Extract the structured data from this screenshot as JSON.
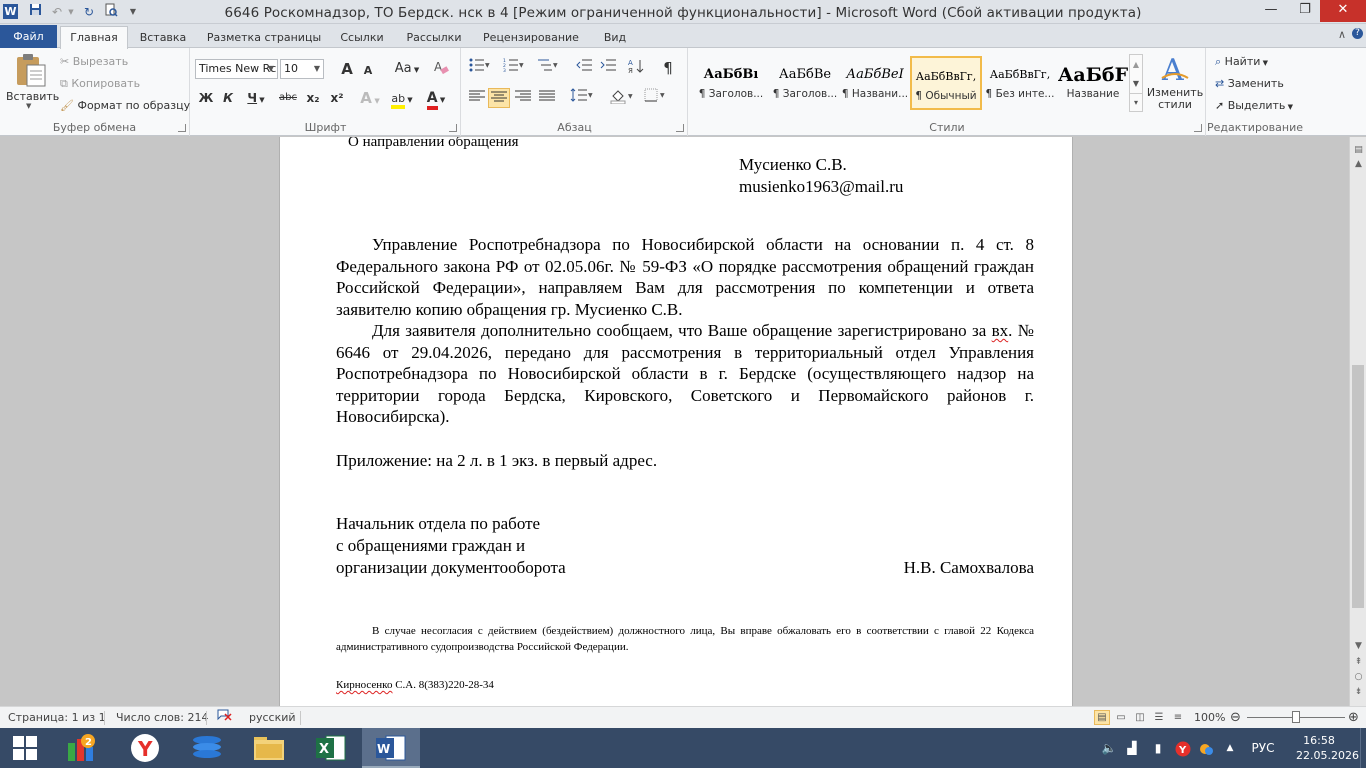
{
  "window": {
    "title": "6646 Роскомнадзор,  ТО Бердск.  нск в 4 [Режим ограниченной функциональности]  -  Microsoft Word (Сбой активации продукта)",
    "app_icon": "W",
    "controls": {
      "minimize": "—",
      "restore": "❐",
      "close": "✕"
    }
  },
  "quick_access": [
    "save-icon",
    "undo-icon",
    "redo-icon",
    "print-preview-icon",
    "customize-icon"
  ],
  "tabs": {
    "file": "Файл",
    "items": [
      "Главная",
      "Вставка",
      "Разметка страницы",
      "Ссылки",
      "Рассылки",
      "Рецензирование",
      "Вид"
    ],
    "active": "Главная"
  },
  "ribbon": {
    "clipboard": {
      "title": "Буфер обмена",
      "paste": "Вставить",
      "cut": "Вырезать",
      "copy": "Копировать",
      "format_painter": "Формат по образцу"
    },
    "font": {
      "title": "Шрифт",
      "family": "Times New Rc",
      "size": "10",
      "grow": "A",
      "shrink": "A",
      "case": "Aa",
      "bold": "Ж",
      "italic": "К",
      "underline": "Ч",
      "strike": "abc",
      "subscript": "x₂",
      "superscript": "x²",
      "effects": "A",
      "highlight": "ab",
      "color": "A"
    },
    "paragraph": {
      "title": "Абзац",
      "pilcrow": "¶"
    },
    "styles": {
      "title": "Стили",
      "items": [
        {
          "sample": "АаБбВı",
          "name": "¶ Заголов..."
        },
        {
          "sample": "АаБбВе",
          "name": "¶ Заголов..."
        },
        {
          "sample": "АаБбВеI",
          "name": "¶ Названи..."
        },
        {
          "sample": "АаБбВвГг,",
          "name": "¶ Обычный"
        },
        {
          "sample": "АаБбВвГг,",
          "name": "¶ Без инте..."
        },
        {
          "sample": "АаБбF",
          "name": "Название"
        }
      ],
      "selected_index": 3,
      "change_styles": "Изменить стили"
    },
    "editing": {
      "title": "Редактирование",
      "find": "Найти",
      "replace": "Заменить",
      "select": "Выделить"
    }
  },
  "document": {
    "partial_line": "О направлении обращения",
    "recipient_name": "Мусиенко С.В.",
    "recipient_email": "musienko1963@mail.ru",
    "para1": "Управление Роспотребнадзора по Новосибирской области на основании п. 4 ст. 8 Федерального закона РФ от 02.05.06г. № 59-ФЗ «О порядке рассмотрения обращений граждан Российской Федерации», направляем Вам для рассмотрения по компетенции и ответа заявителю копию обращения гр. Мусиенко С.В.",
    "para2_before": "Для заявителя дополнительно сообщаем, что Ваше обращение зарегистрировано за ",
    "para2_squiggle": "вх",
    "para2_after": ". № 6646 от 29.04.2026, передано для рассмотрения в территориальный отдел Управления Роспотребнадзора по Новосибирской области в г. Бердске (осуществляющего надзор на территории города Бердска, Кировского, Советского и Первомайского районов г. Новосибирска).",
    "attachment": "Приложение: на 2 л. в 1 экз.  в первый адрес.",
    "signer_line1": "Начальник отдела по работе",
    "signer_line2": "с обращениями граждан и",
    "signer_line3": "организации документооборота",
    "signer_name": "Н.В. Самохвалова",
    "note": "В случае несогласия с действием (бездействием) должностного лица, Вы вправе обжаловать его в соответствии с главой 22 Кодекса административного  судопроизводства Российской Федерации.",
    "executor_name": "Кирносенко",
    "executor_rest": " С.А. 8(383)220-28-34"
  },
  "statusbar": {
    "page": "Страница: 1 из 1",
    "words": "Число слов: 214",
    "language": "русский",
    "zoom": "100%",
    "zoom_percent": 100
  },
  "taskbar": {
    "apps": [
      "windows-start-icon",
      "app-icon",
      "yandex-browser-icon",
      "stack-app-icon",
      "file-explorer-icon",
      "excel-icon",
      "word-icon"
    ],
    "active_app": "word-icon",
    "lang": "РУС",
    "time": "16:58",
    "date": "22.05.2026"
  },
  "colors": {
    "word_blue": "#2b579a",
    "ribbon_bg": "#f8f9fa",
    "selected_style": "#fce4a7",
    "close_red": "#c7312a",
    "taskbar": "#364a66"
  }
}
